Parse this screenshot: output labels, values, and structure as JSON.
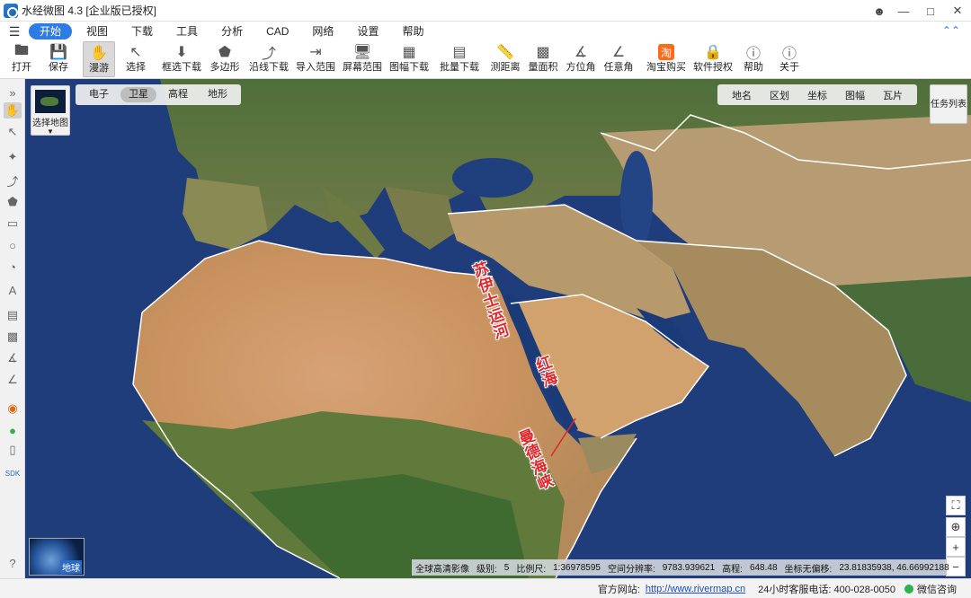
{
  "app": {
    "title": "水经微图 4.3 [企业版已授权]"
  },
  "menu": {
    "items": [
      "开始",
      "视图",
      "下载",
      "工具",
      "分析",
      "CAD",
      "网络",
      "设置",
      "帮助"
    ]
  },
  "toolbar": {
    "open": "打开",
    "save": "保存",
    "pan": "漫游",
    "select": "选择",
    "box_download": "框选下载",
    "polygon": "多边形",
    "line_download": "沿线下载",
    "import_range": "导入范围",
    "screen_range": "屏幕范围",
    "sheet_download": "图幅下载",
    "batch_download": "批量下载",
    "measure_distance": "测距离",
    "measure_area": "量面积",
    "azimuth": "方位角",
    "any_angle": "任意角",
    "taobao": "淘宝购买",
    "license": "软件授权",
    "help": "帮助",
    "about": "关于"
  },
  "map_types": {
    "electronic": "电子",
    "satellite": "卫星",
    "elevation": "高程",
    "terrain": "地形"
  },
  "map_select": {
    "label": "选择地图"
  },
  "overlays": {
    "placename": "地名",
    "district": "区划",
    "coordinate": "坐标",
    "sheet": "图幅",
    "tile": "瓦片"
  },
  "task_list": "任务列表",
  "globe_label": "地球",
  "annotations": {
    "suez": "苏伊士运河",
    "red_sea": "红海",
    "mandeb": "曼德海峡"
  },
  "status": {
    "source": "全球高清影像",
    "level_label": "级别:",
    "level": "5",
    "scale_label": "比例尺:",
    "scale": "1:36978595",
    "resolution_label": "空间分辨率:",
    "resolution": "9783.939621",
    "elevation_label": "高程:",
    "elevation": "648.48",
    "offset_label": "坐标无偏移:",
    "coords": "23.81835938, 46.66992188"
  },
  "footer": {
    "site_label": "官方网站:",
    "site_url": "http://www.rivermap.cn",
    "hotline": "24小时客服电话: 400-028-0050",
    "wechat": "微信咨询"
  },
  "colors": {
    "accent": "#2d7be5",
    "annotation": "#e0262a",
    "ocean": "#1f3d7a"
  }
}
